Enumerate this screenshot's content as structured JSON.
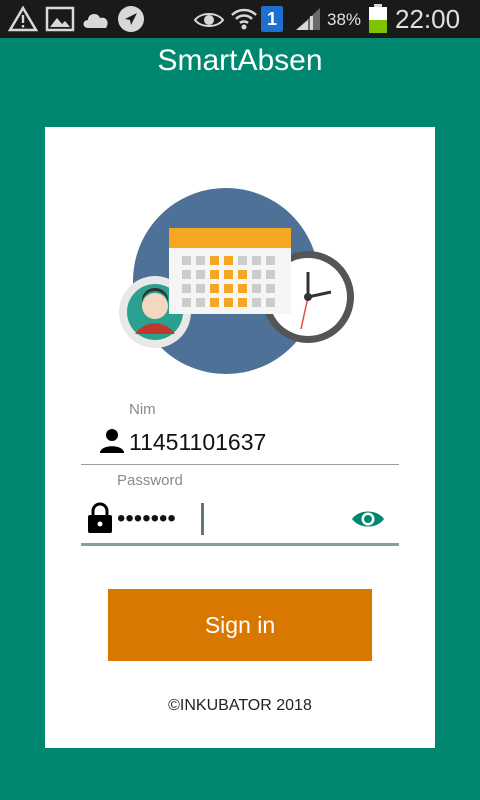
{
  "status_bar": {
    "icons": [
      "warning-icon",
      "image-icon",
      "cloud-icon",
      "navigation-icon",
      "eye-icon",
      "wifi-icon",
      "sim-icon",
      "signal-icon",
      "battery-icon"
    ],
    "sim_badge": "1",
    "battery_percent": "38%",
    "time": "22:00"
  },
  "app": {
    "title": "SmartAbsen"
  },
  "form": {
    "nim_label": "Nim",
    "nim_value": "11451101637",
    "password_label": "Password",
    "password_value": "•••••••",
    "signin_label": "Sign in"
  },
  "footer": {
    "copyright": "©INKUBATOR 2018"
  },
  "colors": {
    "background": "#00876f",
    "card": "#ffffff",
    "button": "#d97800",
    "status_bar": "#1a1a1a",
    "accent": "#00876f"
  }
}
